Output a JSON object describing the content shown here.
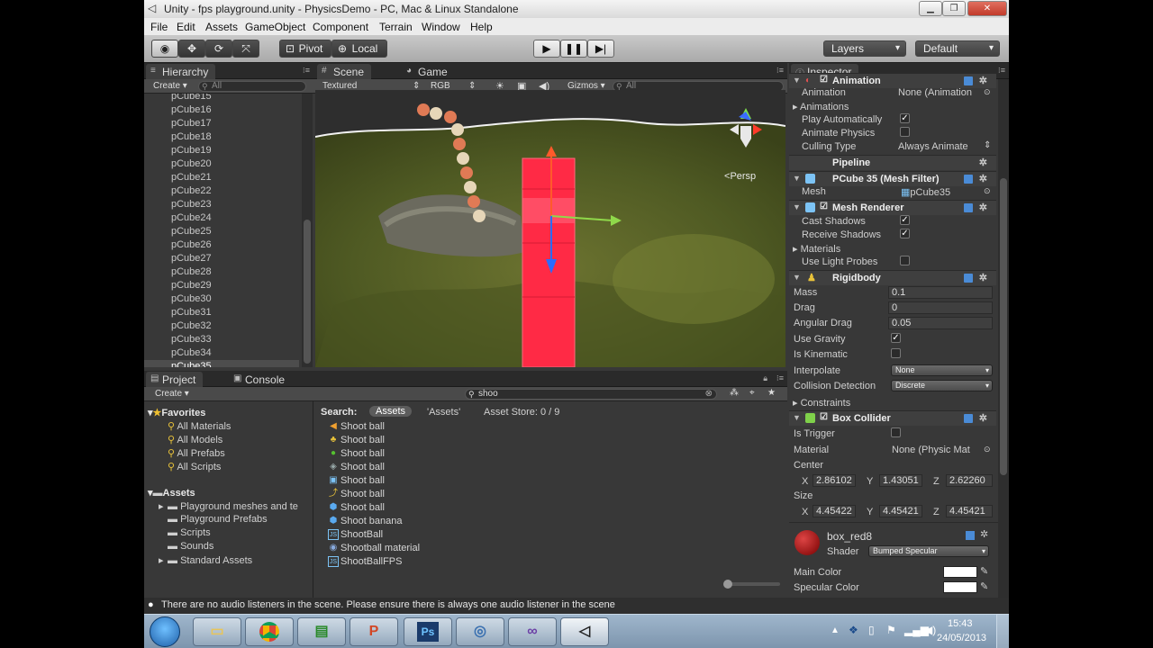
{
  "window": {
    "title": "Unity - fps playground.unity - PhysicsDemo - PC, Mac & Linux Standalone"
  },
  "menu": [
    "File",
    "Edit",
    "Assets",
    "GameObject",
    "Component",
    "Terrain",
    "Window",
    "Help"
  ],
  "toolbar": {
    "pivot_label": "Pivot",
    "local_label": "Local",
    "layers_label": "Layers",
    "layout_label": "Default"
  },
  "hierarchy": {
    "tab_label": "Hierarchy",
    "create_label": "Create",
    "search_placeholder": "All",
    "items": [
      "pCube15",
      "pCube16",
      "pCube17",
      "pCube18",
      "pCube19",
      "pCube20",
      "pCube21",
      "pCube22",
      "pCube23",
      "pCube24",
      "pCube25",
      "pCube26",
      "pCube27",
      "pCube28",
      "pCube29",
      "pCube30",
      "pCube31",
      "pCube32",
      "pCube33",
      "pCube34",
      "pCube35"
    ],
    "selected": "pCube35"
  },
  "scene": {
    "scene_tab_label": "Scene",
    "game_tab_label": "Game",
    "draw_mode": "Textured",
    "render_mode": "RGB",
    "gizmos_label": "Gizmos",
    "search_placeholder": "All",
    "persp_label": "Persp"
  },
  "inspector": {
    "tab_label": "Inspector",
    "animation": {
      "title": "Animation",
      "rows": [
        {
          "label": "Animation",
          "value": "None (Animation"
        },
        {
          "label": "Animations",
          "value": ""
        },
        {
          "label": "Play Automatically",
          "value": "checked"
        },
        {
          "label": "Animate Physics",
          "value": "unchecked"
        },
        {
          "label": "Culling Type",
          "value": "Always Animate"
        }
      ]
    },
    "pipeline_label": "Pipeline",
    "mesh_filter": {
      "title": "PCube 35 (Mesh Filter)",
      "mesh_label": "Mesh",
      "mesh_value": "pCube35"
    },
    "mesh_renderer": {
      "title": "Mesh Renderer",
      "rows": [
        {
          "label": "Cast Shadows",
          "value": "checked"
        },
        {
          "label": "Receive Shadows",
          "value": "checked"
        },
        {
          "label": "Materials",
          "value": ""
        },
        {
          "label": "Use Light Probes",
          "value": "unchecked"
        }
      ]
    },
    "rigidbody": {
      "title": "Rigidbody",
      "mass_label": "Mass",
      "mass": "0.1",
      "drag_label": "Drag",
      "drag": "0",
      "angular_drag_label": "Angular Drag",
      "angular_drag": "0.05",
      "use_gravity_label": "Use Gravity",
      "use_gravity": "checked",
      "is_kinematic_label": "Is Kinematic",
      "is_kinematic": "unchecked",
      "interpolate_label": "Interpolate",
      "interpolate": "None",
      "collision_label": "Collision Detection",
      "collision": "Discrete",
      "constraints_label": "Constraints"
    },
    "box_collider": {
      "title": "Box Collider",
      "is_trigger_label": "Is Trigger",
      "is_trigger": "unchecked",
      "material_label": "Material",
      "material": "None (Physic Mat",
      "center_label": "Center",
      "center": {
        "x": "2.86102",
        "y": "1.43051",
        "z": "2.62260"
      },
      "size_label": "Size",
      "size": {
        "x": "4.45422",
        "y": "4.45421",
        "z": "4.45421"
      },
      "axis_x": "X",
      "axis_y": "Y",
      "axis_z": "Z"
    },
    "material": {
      "name": "box_red8",
      "shader_label": "Shader",
      "shader": "Bumped Specular",
      "main_color_label": "Main Color",
      "specular_color_label": "Specular Color",
      "main_color": "#ffffff",
      "specular_color": "#ffffff"
    }
  },
  "project": {
    "project_tab_label": "Project",
    "console_tab_label": "Console",
    "create_label": "Create",
    "search_value": "shoo",
    "favorites_label": "Favorites",
    "favorites": [
      "All Materials",
      "All Models",
      "All Prefabs",
      "All Scripts"
    ],
    "assets_label": "Assets",
    "folders": [
      "Playground meshes and te",
      "Playground Prefabs",
      "Scripts",
      "Sounds",
      "Standard Assets"
    ],
    "search_label": "Search:",
    "search_scope_active": "Assets",
    "search_scope_other": "'Assets'",
    "asset_store_label": "Asset Store: 0 / 9",
    "results": [
      {
        "name": "Shoot ball",
        "icon": "audio-icon"
      },
      {
        "name": "Shoot ball",
        "icon": "animation-icon"
      },
      {
        "name": "Shoot ball",
        "icon": "material-icon"
      },
      {
        "name": "Shoot ball",
        "icon": "physics-icon"
      },
      {
        "name": "Shoot ball",
        "icon": "prefab-icon"
      },
      {
        "name": "Shoot ball",
        "icon": "animation-clip-icon"
      },
      {
        "name": "Shoot ball",
        "icon": "mesh-icon"
      },
      {
        "name": "Shoot banana",
        "icon": "mesh-icon"
      },
      {
        "name": "ShootBall",
        "icon": "script-icon"
      },
      {
        "name": "Shootball material",
        "icon": "physic-material-icon"
      },
      {
        "name": "ShootBallFPS",
        "icon": "script-icon"
      }
    ]
  },
  "status": {
    "message": "There are no audio listeners in the scene. Please ensure there is always one audio listener in the scene"
  },
  "taskbar": {
    "time": "15:43",
    "date": "24/05/2013",
    "apps": [
      "start-orb",
      "explorer",
      "chrome",
      "notepad",
      "powerpoint",
      "photoshop",
      "utility",
      "visual-studio",
      "unity"
    ]
  }
}
